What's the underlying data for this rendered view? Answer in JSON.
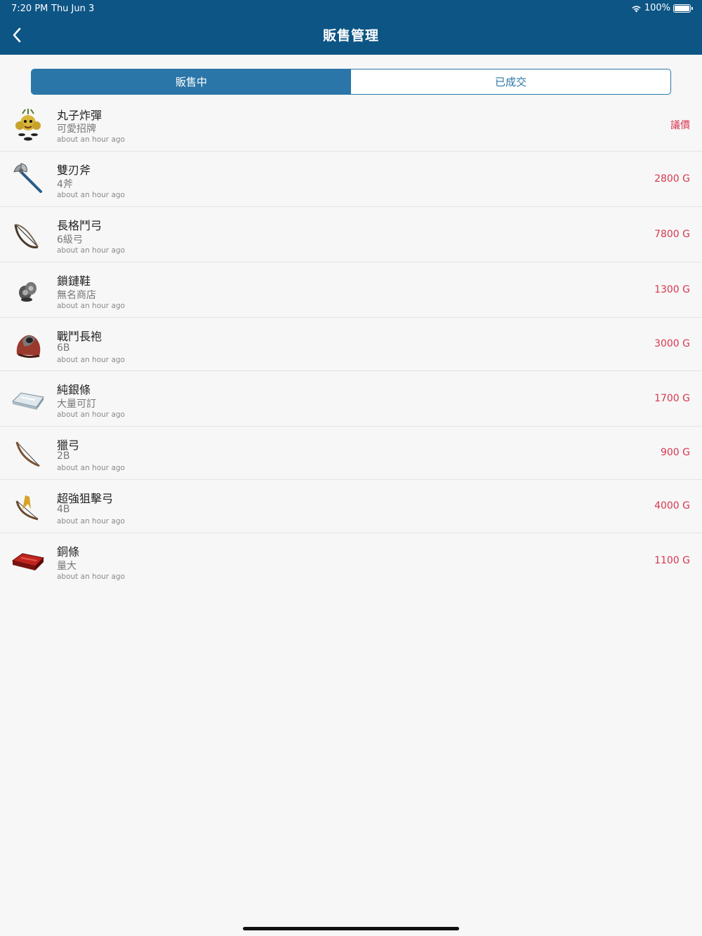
{
  "status": {
    "time": "7:20 PM",
    "date": "Thu Jun 3",
    "battery": "100%"
  },
  "nav": {
    "title": "販售管理",
    "back_icon": "chevron-left-icon"
  },
  "tabs": [
    {
      "label": "販售中",
      "active": true
    },
    {
      "label": "已成交",
      "active": false
    }
  ],
  "items": [
    {
      "name": "丸子炸彈",
      "desc": "可愛招牌",
      "time": "about an hour ago",
      "price": "議價",
      "icon": "bomb-icon"
    },
    {
      "name": "雙刃斧",
      "desc": "4斧",
      "time": "about an hour ago",
      "price": "2800 G",
      "icon": "axe-icon"
    },
    {
      "name": "長格鬥弓",
      "desc": "6級弓",
      "time": "about an hour ago",
      "price": "7800 G",
      "icon": "bow-icon"
    },
    {
      "name": "鎖鏈鞋",
      "desc": "無名商店",
      "time": "about an hour ago",
      "price": "1300 G",
      "icon": "boots-icon"
    },
    {
      "name": "戰鬥長袍",
      "desc": "6B",
      "time": "about an hour ago",
      "price": "3000 G",
      "icon": "robe-icon"
    },
    {
      "name": "純銀條",
      "desc": "大量可訂",
      "time": "about an hour ago",
      "price": "1700 G",
      "icon": "silver-bar-icon"
    },
    {
      "name": "獵弓",
      "desc": "2B",
      "time": "about an hour ago",
      "price": "900 G",
      "icon": "hunting-bow-icon"
    },
    {
      "name": "超強狙擊弓",
      "desc": "4B",
      "time": "about an hour ago",
      "price": "4000 G",
      "icon": "sniper-bow-icon"
    },
    {
      "name": "銅條",
      "desc": "量大",
      "time": "about an hour ago",
      "price": "1100 G",
      "icon": "copper-bar-icon"
    }
  ],
  "colors": {
    "header": "#0d5585",
    "accent": "#2b76a8",
    "price": "#d6374f"
  }
}
